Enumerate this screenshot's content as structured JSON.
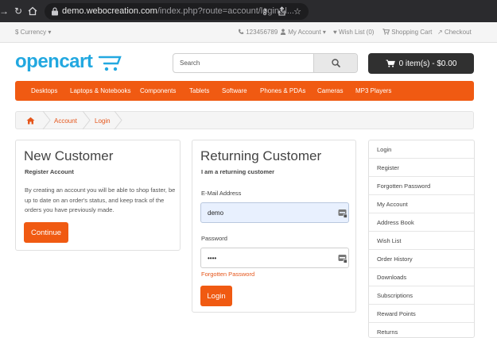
{
  "browser": {
    "url_host": "demo.webocreation.com",
    "url_path": "/index.php?route=account/login&l..."
  },
  "topbar": {
    "currency": "$ Currency",
    "phone": "123456789",
    "my_account": "My Account",
    "wish_list": "Wish List (0)",
    "shopping_cart": "Shopping Cart",
    "checkout": "Checkout"
  },
  "header": {
    "logo": "opencart",
    "search_placeholder": "Search",
    "cart_label": "0 item(s) - $0.00"
  },
  "menu": {
    "items": [
      "Desktops",
      "Laptops & Notebooks",
      "Components",
      "Tablets",
      "Software",
      "Phones & PDAs",
      "Cameras",
      "MP3 Players"
    ]
  },
  "breadcrumb": {
    "items": [
      "Account",
      "Login"
    ]
  },
  "new_customer": {
    "title": "New Customer",
    "subtitle": "Register Account",
    "description": "By creating an account you will be able to shop faster, be up to date on an order's status, and keep track of the orders you have previously made.",
    "continue_label": "Continue"
  },
  "returning_customer": {
    "title": "Returning Customer",
    "subtitle": "I am a returning customer",
    "email_label": "E-Mail Address",
    "email_value": "demo",
    "password_label": "Password",
    "password_value": "demo",
    "forgotten_label": "Forgotten Password",
    "login_label": "Login"
  },
  "sidebar": {
    "items": [
      "Login",
      "Register",
      "Forgotten Password",
      "My Account",
      "Address Book",
      "Wish List",
      "Order History",
      "Downloads",
      "Subscriptions",
      "Reward Points",
      "Returns"
    ]
  },
  "colors": {
    "accent": "#f05a12",
    "logo_blue": "#22a8e0",
    "cart_dark": "#303030"
  }
}
